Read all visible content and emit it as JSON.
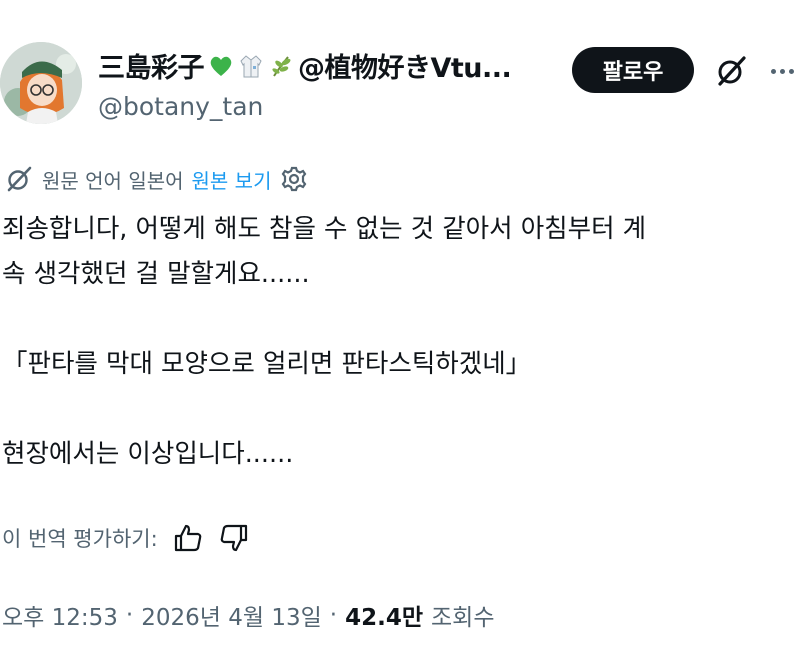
{
  "author": {
    "display_name": "三島彩子",
    "name_suffix": "@植物好きVtu...",
    "handle": "@botany_tan",
    "badges": [
      "green-heart-icon",
      "lab-coat-icon",
      "sprout-icon"
    ]
  },
  "actions": {
    "follow_label": "팔로우",
    "grok_icon": "grok-icon",
    "more_icon": "more-icon"
  },
  "translation": {
    "source_label": "원문 언어 일본어",
    "view_original_label": "원본 보기"
  },
  "tweet": {
    "lines": [
      "죄송합니다, 어떻게 해도 참을 수 없는 것 같아서 아침부터 계",
      "속 생각했던 걸 말할게요......",
      "「판타를 막대 모양으로 얼리면 판타스틱하겠네」",
      "현장에서는 이상입니다......"
    ]
  },
  "rating": {
    "label": "이 번역 평가하기:"
  },
  "meta": {
    "time": "오후 12:53",
    "date": "2026년 4월 13일",
    "views_count": "42.4만",
    "views_label": "조회수",
    "separator": "·"
  },
  "colors": {
    "text": "#0f1419",
    "secondary": "#536471",
    "link": "#1d9bf0",
    "follow_bg": "#0f1419",
    "heart": "#3cb34a"
  }
}
